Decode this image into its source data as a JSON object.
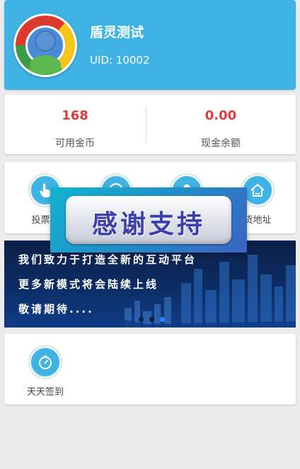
{
  "profile": {
    "username": "盾灵测试",
    "uid": "UID: 10002"
  },
  "balance": {
    "coins_value": "168",
    "coins_label": "可用金币",
    "cash_value": "0.00",
    "cash_label": "现金余额"
  },
  "menu": {
    "items": [
      {
        "label": "投票活",
        "icon": "hand-pointer-icon"
      },
      {
        "label": "",
        "icon": "compass-icon"
      },
      {
        "label": "",
        "icon": "user-icon"
      },
      {
        "label": "货地址",
        "icon": "home-icon"
      }
    ]
  },
  "popup": {
    "text": "感谢支持"
  },
  "banner": {
    "lines": [
      "我们致力于打造全新的互动平台",
      "更多新模式将会陆续上线",
      "敬请期待...."
    ],
    "active_slide": 2
  },
  "signin": {
    "label": "天天签到",
    "icon": "stopwatch-icon"
  },
  "colors": {
    "accent": "#3fb3e3",
    "value_red": "#e4393c"
  }
}
